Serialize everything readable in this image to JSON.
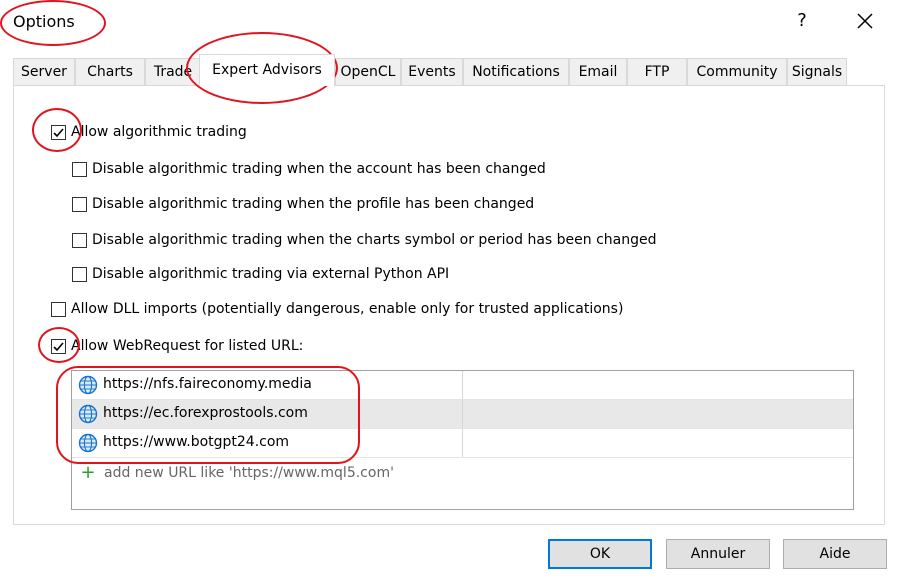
{
  "window": {
    "title": "Options",
    "help": "?",
    "close_icon": "close-icon"
  },
  "tabs": [
    {
      "label": "Server"
    },
    {
      "label": "Charts"
    },
    {
      "label": "Trade"
    },
    {
      "label": "Expert Advisors",
      "active": true
    },
    {
      "label": "OpenCL"
    },
    {
      "label": "Events"
    },
    {
      "label": "Notifications"
    },
    {
      "label": "Email"
    },
    {
      "label": "FTP"
    },
    {
      "label": "Community"
    },
    {
      "label": "Signals"
    }
  ],
  "options": {
    "allow_algo": {
      "label": "Allow algorithmic trading",
      "checked": true
    },
    "disable_account": {
      "label": "Disable algorithmic trading when the account has been changed",
      "checked": false
    },
    "disable_profile": {
      "label": "Disable algorithmic trading when the profile has been changed",
      "checked": false
    },
    "disable_symbol": {
      "label": "Disable algorithmic trading when the charts symbol or period has been changed",
      "checked": false
    },
    "disable_python": {
      "label": "Disable algorithmic trading via external Python API",
      "checked": false
    },
    "allow_dll": {
      "label": "Allow DLL imports (potentially dangerous, enable only for trusted applications)",
      "checked": false
    },
    "allow_webrequest": {
      "label": "Allow WebRequest for listed URL:",
      "checked": true
    }
  },
  "url_list": {
    "urls": [
      {
        "url": "https://nfs.faireconomy.media",
        "icon": "globe-icon"
      },
      {
        "url": "https://ec.forexprostools.com",
        "icon": "globe-icon",
        "selected": true
      },
      {
        "url": "https://www.botgpt24.com",
        "icon": "globe-icon"
      }
    ],
    "add_placeholder": "add new URL like 'https://www.mql5.com'",
    "add_icon": "plus-icon"
  },
  "buttons": {
    "ok": "OK",
    "cancel": "Annuler",
    "help": "Aide"
  },
  "colors": {
    "annotation": "#e0141e",
    "globe": "#1a73c9",
    "plus": "#2aa12a",
    "default_button_border": "#0078d7"
  }
}
